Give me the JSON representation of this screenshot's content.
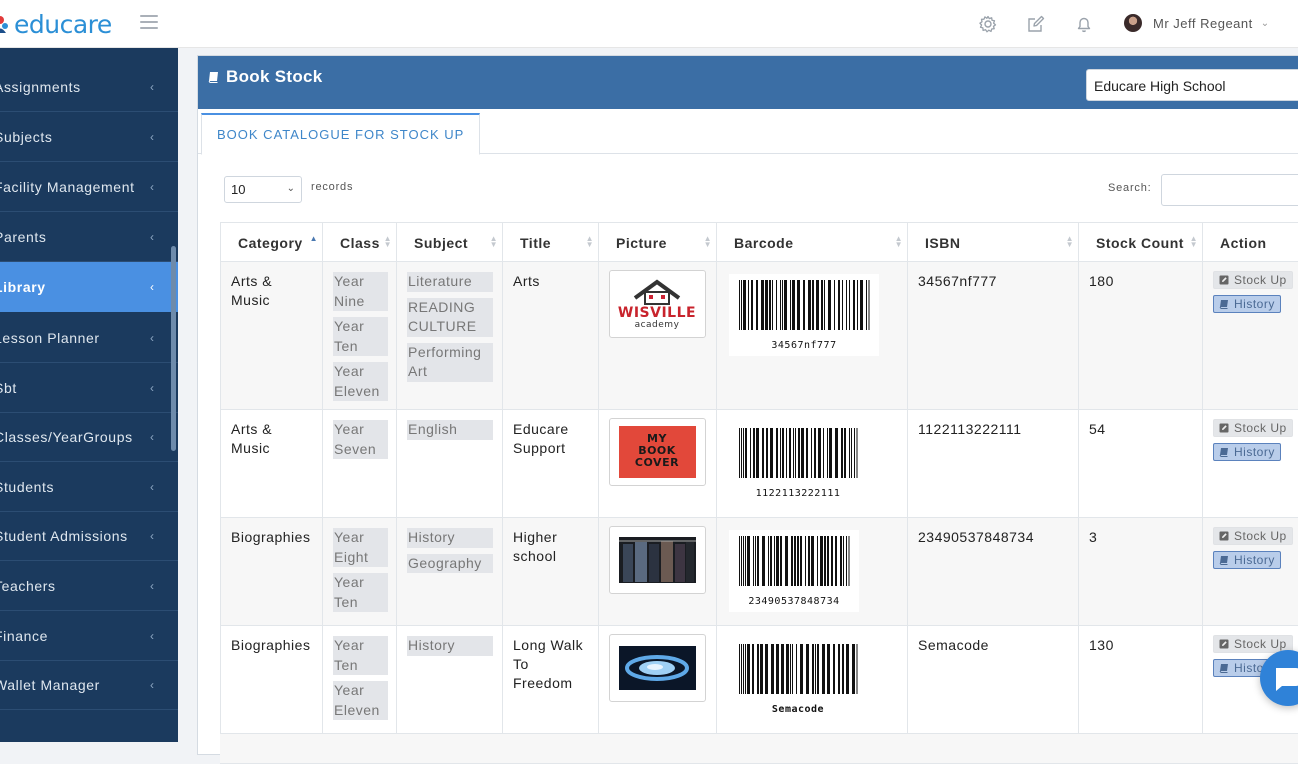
{
  "app": {
    "brand": "educare"
  },
  "header": {
    "user_name": "Mr Jeff Regeant",
    "icons": [
      "gear-icon",
      "edit-icon",
      "bell-icon"
    ]
  },
  "sidebar": {
    "items": [
      {
        "label": "Assignments"
      },
      {
        "label": "Subjects"
      },
      {
        "label": "Facility Management"
      },
      {
        "label": "Parents"
      },
      {
        "label": "Library",
        "active": true
      },
      {
        "label": "Lesson Planner"
      },
      {
        "label": "Sbt"
      },
      {
        "label": "Classes/YearGroups"
      },
      {
        "label": "Students"
      },
      {
        "label": "Student Admissions"
      },
      {
        "label": "Teachers"
      },
      {
        "label": "Finance"
      },
      {
        "label": "Wallet Manager"
      }
    ]
  },
  "panel": {
    "title": "Book Stock",
    "school": "Educare High School",
    "tab": "BOOK CATALOGUE FOR STOCK UP",
    "length_value": "10",
    "records_label": "records",
    "search_label": "Search:"
  },
  "table": {
    "columns": [
      "Category",
      "Class",
      "Subject",
      "Title",
      "Picture",
      "Barcode",
      "ISBN",
      "Stock Count",
      "Action"
    ],
    "action_labels": {
      "stock": "Stock Up",
      "history": "History"
    },
    "rows": [
      {
        "category": "Arts & Music",
        "classes": [
          "Year Nine",
          "Year Ten",
          "Year Eleven"
        ],
        "subjects": [
          "Literature",
          "READING CULTURE",
          "Performing Art"
        ],
        "title": "Arts",
        "picture": "wisville-academy-logo",
        "barcode": "34567nf777",
        "isbn": "34567nf777",
        "stock": "180"
      },
      {
        "category": "Arts & Music",
        "classes": [
          "Year Seven"
        ],
        "subjects": [
          "English"
        ],
        "title": "Educare Support",
        "picture": "my-book-cover",
        "barcode": "1122113222111",
        "isbn": "1122113222111",
        "stock": "54"
      },
      {
        "category": "Biographies",
        "classes": [
          "Year Eight",
          "Year Ten"
        ],
        "subjects": [
          "History",
          "Geography"
        ],
        "title": "Higher school",
        "picture": "suits-photo",
        "barcode": "23490537848734",
        "isbn": "23490537848734",
        "stock": "3"
      },
      {
        "category": "Biographies",
        "classes": [
          "Year Ten",
          "Year Eleven"
        ],
        "subjects": [
          "History"
        ],
        "title": "Long Walk To Freedom",
        "picture": "abstract-blue-photo",
        "barcode": "Semacode",
        "isbn": "Semacode",
        "stock": "130"
      }
    ]
  },
  "colors": {
    "sidebar": "#1b3a5e",
    "active": "#4a90e2",
    "panel_head": "#3b6ea5",
    "brand": "#2b8fd6"
  }
}
